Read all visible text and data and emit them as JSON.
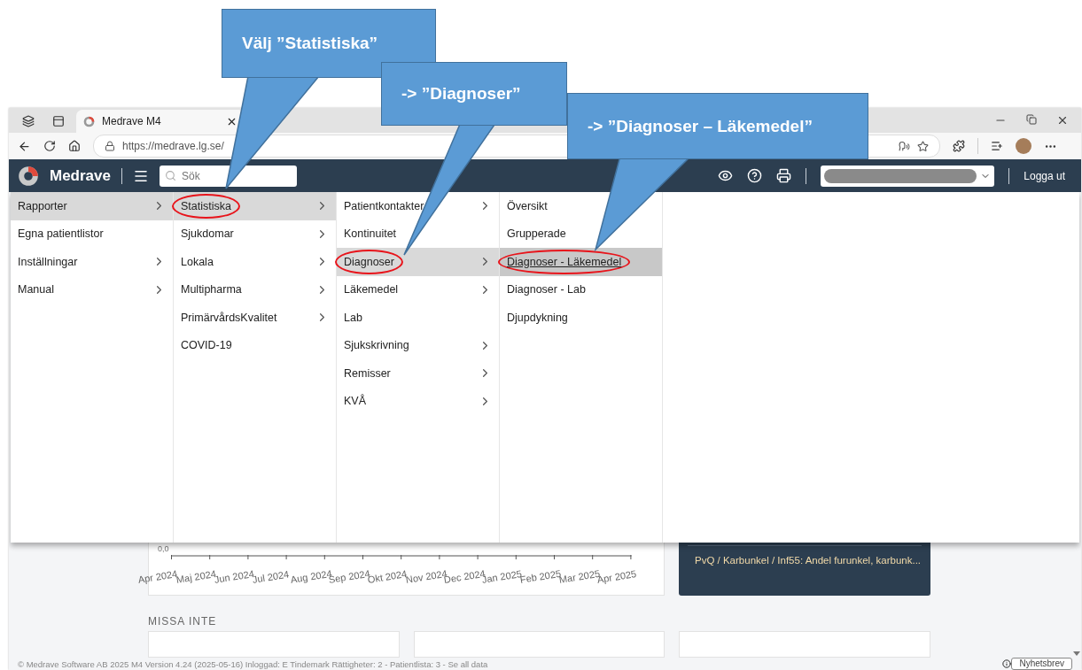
{
  "browser": {
    "tab_title": "Medrave M4",
    "url": "https://medrave.lg.se/"
  },
  "app": {
    "brand": "Medrave",
    "search": {
      "placeholder": "Sök"
    },
    "logout": "Logga ut"
  },
  "menu_columns": [
    [
      {
        "label": "Rapporter",
        "selected": true,
        "submenu": true,
        "circled": false
      },
      {
        "label": "Egna patientlistor",
        "selected": false,
        "submenu": false,
        "circled": false
      },
      {
        "label": "Inställningar",
        "selected": false,
        "submenu": true,
        "circled": false
      },
      {
        "label": "Manual",
        "selected": false,
        "submenu": true,
        "circled": false
      }
    ],
    [
      {
        "label": "Statistiska",
        "selected": true,
        "submenu": true,
        "circled": true
      },
      {
        "label": "Sjukdomar",
        "selected": false,
        "submenu": true,
        "circled": false
      },
      {
        "label": "Lokala",
        "selected": false,
        "submenu": true,
        "circled": false
      },
      {
        "label": "Multipharma",
        "selected": false,
        "submenu": true,
        "circled": false
      },
      {
        "label": "PrimärvårdsKvalitet",
        "selected": false,
        "submenu": true,
        "circled": false
      },
      {
        "label": "COVID-19",
        "selected": false,
        "submenu": false,
        "circled": false
      }
    ],
    [
      {
        "label": "Patientkontakter",
        "selected": false,
        "submenu": true,
        "circled": false
      },
      {
        "label": "Kontinuitet",
        "selected": false,
        "submenu": false,
        "circled": false
      },
      {
        "label": "Diagnoser",
        "selected": true,
        "submenu": true,
        "circled": true
      },
      {
        "label": "Läkemedel",
        "selected": false,
        "submenu": true,
        "circled": false
      },
      {
        "label": "Lab",
        "selected": false,
        "submenu": false,
        "circled": false
      },
      {
        "label": "Sjukskrivning",
        "selected": false,
        "submenu": true,
        "circled": false
      },
      {
        "label": "Remisser",
        "selected": false,
        "submenu": true,
        "circled": false
      },
      {
        "label": "KVÅ",
        "selected": false,
        "submenu": true,
        "circled": false
      }
    ],
    [
      {
        "label": "Översikt",
        "selected": false,
        "submenu": false,
        "circled": false
      },
      {
        "label": "Grupperade",
        "selected": false,
        "submenu": false,
        "circled": false
      },
      {
        "label": "Diagnoser - Läkemedel",
        "selected": true,
        "submenu": false,
        "circled": true
      },
      {
        "label": "Diagnoser - Lab",
        "selected": false,
        "submenu": false,
        "circled": false
      },
      {
        "label": "Djupdykning",
        "selected": false,
        "submenu": false,
        "circled": false
      }
    ]
  ],
  "chart": {
    "y_label": "0,0",
    "months": [
      "Apr 2024",
      "Maj 2024",
      "Jun 2024",
      "Jul 2024",
      "Aug 2024",
      "Sep 2024",
      "Okt 2024",
      "Nov 2024",
      "Dec 2024",
      "Jan 2025",
      "Feb 2025",
      "Mar 2025",
      "Apr 2025"
    ]
  },
  "highlight_card": {
    "text": "PvQ / Karbunkel / Inf55: Andel furunkel, karbunk..."
  },
  "missa_inte": {
    "heading": "MISSA INTE"
  },
  "footer": {
    "text": "© Medrave Software AB 2025 M4 Version 4.24 (2025-05-16) Inloggad: E Tindemark Rättigheter: 2 - Patientlista: 3 - Se all data",
    "button": "Nyhetsbrev"
  },
  "callouts": [
    {
      "text": "Välj ”Statistiska”"
    },
    {
      "text": "-> ”Diagnoser”"
    },
    {
      "text": "-> ”Diagnoser – Läkemedel”"
    }
  ]
}
